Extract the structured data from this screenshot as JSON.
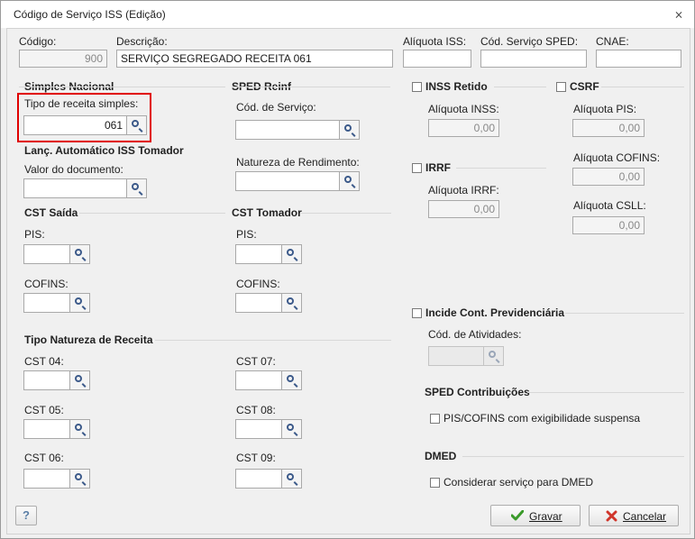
{
  "window": {
    "title": "Código de Serviço ISS (Edição)",
    "close_glyph": "⨯"
  },
  "header": {
    "codigo_label": "Código:",
    "codigo_value": "900",
    "descricao_label": "Descrição:",
    "descricao_value": "SERVIÇO SEGREGADO RECEITA 061",
    "aliquota_iss_label": "Alíquota ISS:",
    "aliquota_iss_value": "",
    "cod_servico_sped_label": "Cód. Serviço SPED:",
    "cod_servico_sped_value": "",
    "cnae_label": "CNAE:",
    "cnae_value": ""
  },
  "simples_nacional": {
    "title": "Simples Nacional",
    "tipo_receita_label": "Tipo de receita simples:",
    "tipo_receita_value": "061"
  },
  "lanc_auto": {
    "title": "Lanç. Automático ISS Tomador",
    "valor_documento_label": "Valor do documento:",
    "valor_documento_value": ""
  },
  "sped_reinf": {
    "title": "SPED Reinf",
    "cod_servico_label": "Cód. de Serviço:",
    "natureza_rendimento_label": "Natureza de Rendimento:"
  },
  "cst_saida": {
    "title": "CST Saída",
    "pis_label": "PIS:",
    "cofins_label": "COFINS:"
  },
  "cst_tomador": {
    "title": "CST Tomador",
    "pis_label": "PIS:",
    "cofins_label": "COFINS:"
  },
  "tipo_natureza": {
    "title": "Tipo Natureza de Receita",
    "cst04": "CST 04:",
    "cst05": "CST 05:",
    "cst06": "CST 06:",
    "cst07": "CST 07:",
    "cst08": "CST 08:",
    "cst09": "CST 09:"
  },
  "inss": {
    "checkbox_label": "INSS Retido",
    "aliquota_label": "Alíquota INSS:",
    "aliquota_value": "0,00"
  },
  "irrf": {
    "checkbox_label": "IRRF",
    "aliquota_label": "Alíquota IRRF:",
    "aliquota_value": "0,00"
  },
  "csrf": {
    "checkbox_label": "CSRF",
    "aliquota_pis_label": "Alíquota PIS:",
    "aliquota_pis_value": "0,00",
    "aliquota_cofins_label": "Alíquota COFINS:",
    "aliquota_cofins_value": "0,00",
    "aliquota_csll_label": "Alíquota CSLL:",
    "aliquota_csll_value": "0,00"
  },
  "previdenciaria": {
    "checkbox_label": "Incide Cont. Previdenciária",
    "cod_atividades_label": "Cód. de Atividades:"
  },
  "sped_contribuicoes": {
    "title": "SPED Contribuições",
    "checkbox_label": "PIS/COFINS com exigibilidade suspensa"
  },
  "dmed": {
    "title": "DMED",
    "checkbox_label": "Considerar serviço para DMED"
  },
  "footer": {
    "help_label": "?",
    "gravar_label": "Gravar",
    "cancelar_label": "Cancelar"
  },
  "colors": {
    "highlight": "#e00000",
    "check_green": "#3a9a2a",
    "cancel_red": "#d0352b"
  }
}
